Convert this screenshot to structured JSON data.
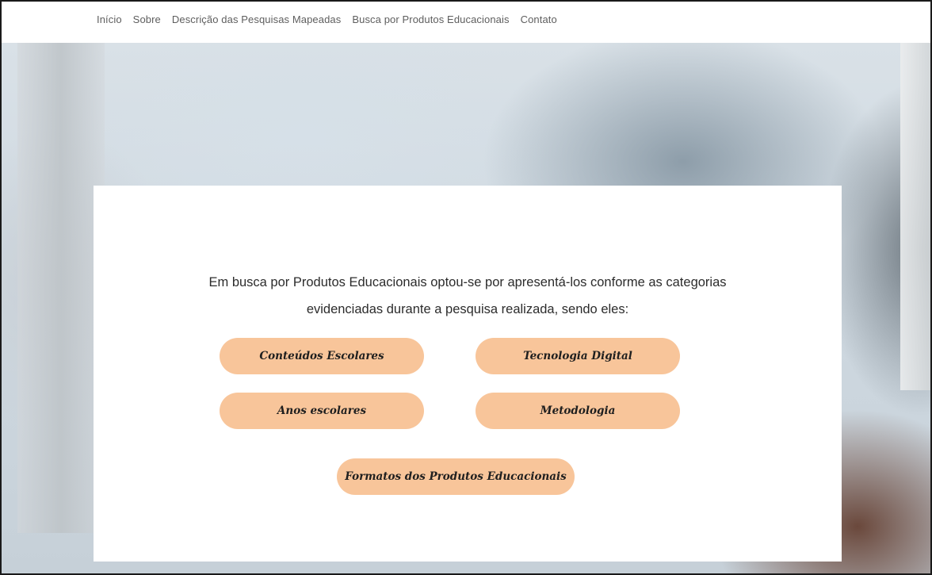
{
  "nav": {
    "items": [
      "Início",
      "Sobre",
      "Descrição das Pesquisas Mapeadas",
      "Busca por Produtos Educacionais",
      "Contato"
    ]
  },
  "intro": {
    "line1": "Em busca por Produtos Educacionais optou-se por apresentá-los conforme as categorias",
    "line2": "evidenciadas durante a pesquisa realizada, sendo eles:"
  },
  "categories": [
    "Conteúdos Escolares",
    "Tecnologia Digital",
    "Anos escolares",
    "Metodologia",
    "Formatos dos Produtos Educacionais"
  ],
  "colors": {
    "button_bg": "#f8c59a",
    "panel_bg": "#ffffff",
    "nav_text": "#5e5e5e",
    "body_text": "#2c2c2c"
  }
}
